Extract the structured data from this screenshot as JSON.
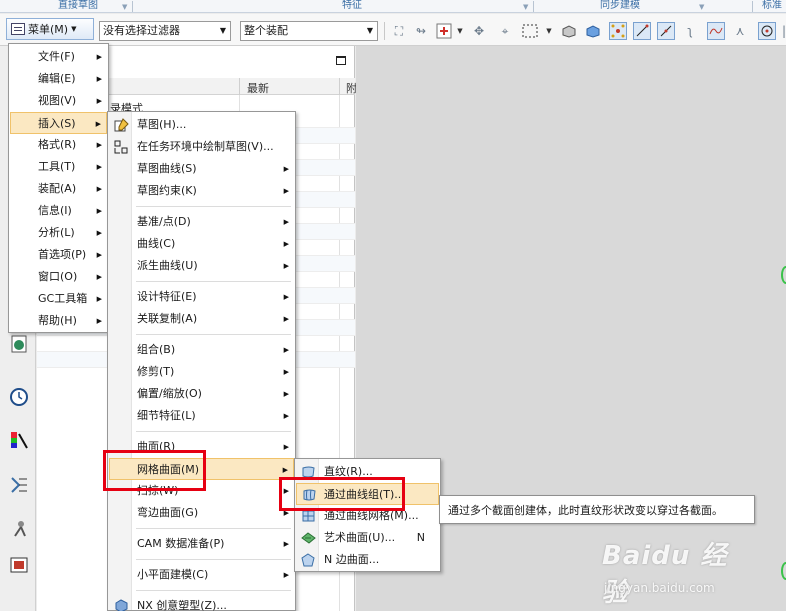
{
  "ribbon_groups": [
    "直接草图",
    "特征",
    "同步建模",
    "标准"
  ],
  "toolbar": {
    "menu_button_label": "菜单(M)",
    "filter_select": "没有选择过滤器",
    "scope_select": "整个装配"
  },
  "navigator": {
    "columns": [
      "最新",
      "附"
    ],
    "visible_row_text": "录模式"
  },
  "main_menu": [
    {
      "label": "文件(F)"
    },
    {
      "label": "编辑(E)"
    },
    {
      "label": "视图(V)"
    },
    {
      "label": "插入(S)",
      "highlighted": true
    },
    {
      "label": "格式(R)"
    },
    {
      "label": "工具(T)"
    },
    {
      "label": "装配(A)"
    },
    {
      "label": "信息(I)"
    },
    {
      "label": "分析(L)"
    },
    {
      "label": "首选项(P)"
    },
    {
      "label": "窗口(O)"
    },
    {
      "label": "GC工具箱"
    },
    {
      "label": "帮助(H)"
    }
  ],
  "insert_menu": {
    "sketch": "草图(H)...",
    "sketch_in_task": "在任务环境中绘制草图(V)...",
    "sketch_curve": "草图曲线(S)",
    "sketch_constraint": "草图约束(K)",
    "datum_point": "基准/点(D)",
    "curve": "曲线(C)",
    "derived_curve": "派生曲线(U)",
    "design_feature": "设计特征(E)",
    "associative_copy": "关联复制(A)",
    "combine": "组合(B)",
    "trim": "修剪(T)",
    "offset_scale": "偏置/缩放(O)",
    "detail_feature": "细节特征(L)",
    "surface": "曲面(R)",
    "mesh_surface": "网格曲面(M)",
    "sweep": "扫掠(W)",
    "flange_surface": "弯边曲面(G)",
    "cam_prep": "CAM 数据准备(P)",
    "planar_modeling": "小平面建模(C)",
    "nx_realize_shape": "NX 创意塑型(Z)..."
  },
  "mesh_menu": {
    "ruled": "直纹(R)...",
    "through_curves": "通过曲线组(T)...",
    "through_curve_mesh": "通过曲线网格(M)...",
    "studio_surface": "艺术曲面(U)...",
    "studio_accel": "N",
    "n_sided": "N 边曲面..."
  },
  "tooltip": "通过多个截面创建体，此时直纹形状改变以穿过各截面。",
  "watermark": {
    "brand": "Baidu 经验",
    "url": "jingyan.baidu.com"
  },
  "colors": {
    "highlight": "#fbe8c2",
    "red_box": "#e60012",
    "ribbon_text": "#3a6ea5"
  }
}
